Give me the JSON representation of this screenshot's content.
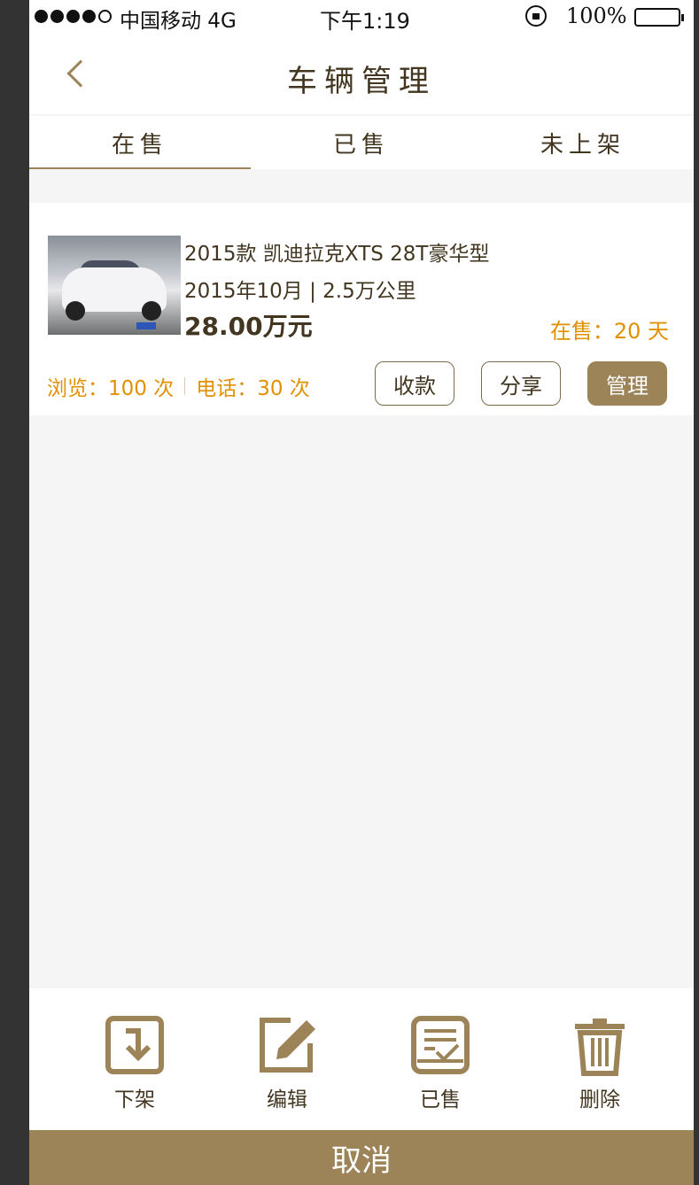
{
  "status_bar": {
    "carrier": "中国移动 4G",
    "time": "下午1:19",
    "battery": "100%",
    "signal_dots_filled": 4,
    "signal_dots_total": 5
  },
  "navbar": {
    "title": "车辆管理",
    "back_icon": "chevron-left-icon"
  },
  "tabs": [
    {
      "label": "在售",
      "active": true
    },
    {
      "label": "已售",
      "active": false
    },
    {
      "label": "未上架",
      "active": false
    }
  ],
  "listing": {
    "title": "2015款 凯迪拉克XTS 28T豪华型",
    "meta": "2015年10月 | 2.5万公里",
    "price": "28.00万元",
    "on_sale": "在售：20 天",
    "views": "浏览：100 次",
    "calls": "电话：30 次",
    "buttons": {
      "collect": "收款",
      "share": "分享",
      "manage": "管理"
    }
  },
  "action_sheet": {
    "items": [
      {
        "label": "下架",
        "icon": "take-down-icon"
      },
      {
        "label": "编辑",
        "icon": "edit-icon"
      },
      {
        "label": "已售",
        "icon": "sold-icon"
      },
      {
        "label": "删除",
        "icon": "trash-icon"
      }
    ],
    "cancel": "取消"
  },
  "colors": {
    "brand": "#9c8458",
    "text": "#423621",
    "accent": "#e29000",
    "background": "#f5f5f5"
  }
}
